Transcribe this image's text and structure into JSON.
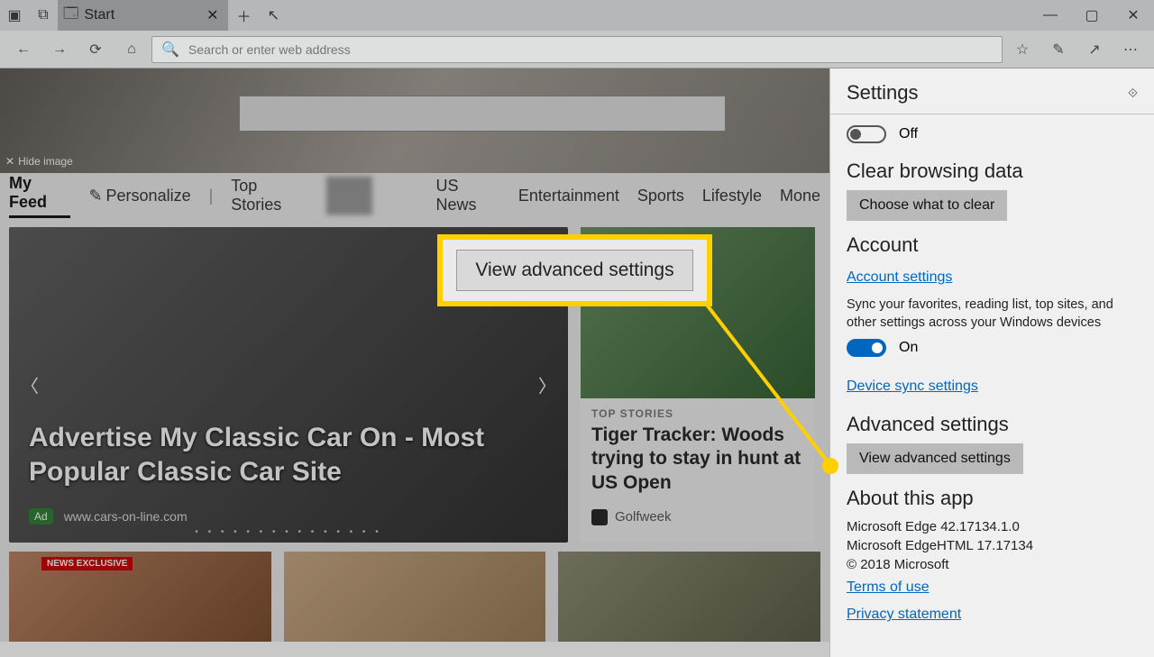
{
  "titlebar": {
    "tab_title": "Start",
    "min": "—",
    "max": "▢",
    "close": "✕"
  },
  "toolbar": {
    "search_placeholder": "Search or enter web address"
  },
  "hero": {
    "hide_image": "Hide image"
  },
  "feedbar": {
    "my_feed": "My Feed",
    "personalize": "Personalize",
    "top_stories": "Top Stories",
    "us_news": "US News",
    "entertainment": "Entertainment",
    "sports": "Sports",
    "lifestyle": "Lifestyle",
    "money": "Mone"
  },
  "main_tile": {
    "headline": "Advertise My Classic Car On - Most Popular Classic Car Site",
    "ad": "Ad",
    "source": "www.cars-on-line.com",
    "dots": "• • • • • • • • • • • • • • •"
  },
  "side_tile": {
    "category": "TOP STORIES",
    "title": "Tiger Tracker: Woods trying to stay in hunt at US Open",
    "source": "Golfweek"
  },
  "thumb1_badge": "NEWS EXCLUSIVE",
  "callout": {
    "label": "View advanced settings"
  },
  "settings": {
    "title": "Settings",
    "off": "Off",
    "clear_data": "Clear browsing data",
    "choose_clear": "Choose what to clear",
    "account": "Account",
    "account_settings": "Account settings",
    "sync_desc": "Sync your favorites, reading list, top sites, and other settings across your Windows devices",
    "on": "On",
    "device_sync": "Device sync settings",
    "advanced": "Advanced settings",
    "view_advanced": "View advanced settings",
    "about": "About this app",
    "about_line1": "Microsoft Edge 42.17134.1.0",
    "about_line2": "Microsoft EdgeHTML 17.17134",
    "about_line3": "© 2018 Microsoft",
    "terms": "Terms of use",
    "privacy": "Privacy statement"
  }
}
